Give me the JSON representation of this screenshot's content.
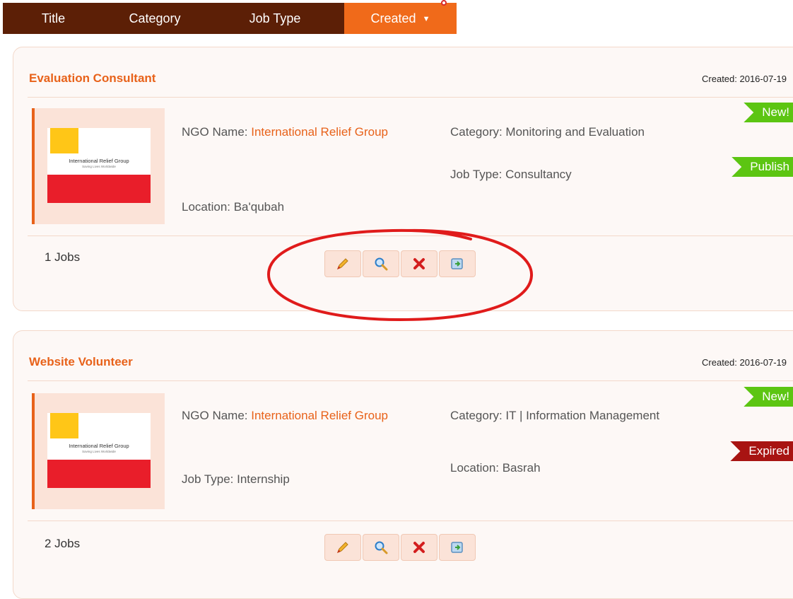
{
  "sort_bar": {
    "tabs": [
      "Title",
      "Category",
      "Job Type",
      "Created"
    ],
    "active": "Created",
    "active_icon": "sort-down-icon",
    "colors": {
      "bar": "#5c1f06",
      "active": "#f06a1a"
    }
  },
  "jobs": [
    {
      "title": "Evaluation Consultant",
      "created": "Created: 2016-07-19",
      "logo": {
        "name": "International Relief Group",
        "tagline": "Saving Lives Worldwide"
      },
      "ngo_label": "NGO Name: ",
      "ngo_value": "International Relief Group",
      "left_extra": "Location: Ba'qubah",
      "category": "Category: Monitoring and Evaluation",
      "right_extra": "Job Type: Consultancy",
      "badges": [
        "New!",
        "Publish"
      ],
      "jobs_count": "1 Jobs",
      "actions": [
        "edit-icon",
        "view-icon",
        "delete-icon",
        "export-icon"
      ]
    },
    {
      "title": "Website Volunteer",
      "created": "Created: 2016-07-19",
      "logo": {
        "name": "International Relief Group",
        "tagline": "Saving Lives Worldwide"
      },
      "ngo_label": "NGO Name: ",
      "ngo_value": "International Relief Group",
      "left_extra": "Job Type: Internship",
      "category": "Category: IT | Information Management",
      "right_extra": "Location: Basrah",
      "badges": [
        "New!",
        "Expired"
      ],
      "jobs_count": "2 Jobs",
      "actions": [
        "edit-icon",
        "view-icon",
        "delete-icon",
        "export-icon"
      ]
    }
  ],
  "colors": {
    "accent": "#e8621a",
    "new": "#5cc512",
    "expired": "#a81412",
    "annotation": "#e01b1b"
  }
}
